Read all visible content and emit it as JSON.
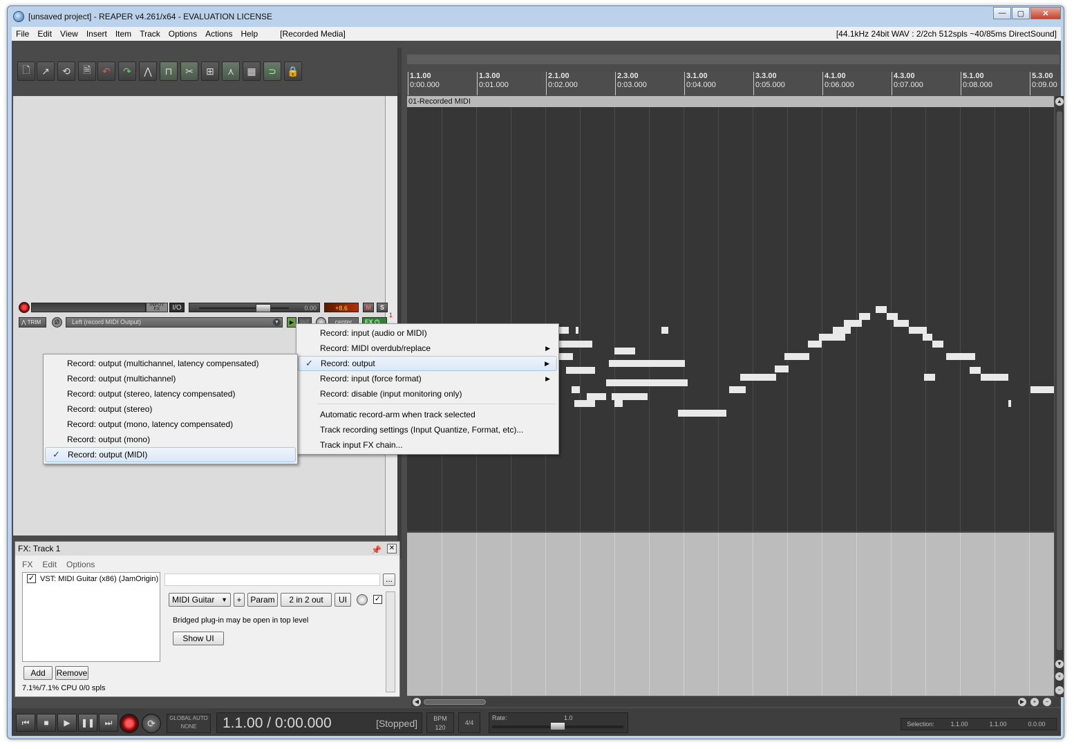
{
  "window": {
    "title": "[unsaved project] - REAPER v4.261/x64 - EVALUATION LICENSE",
    "minimize": "—",
    "maximize": "▢",
    "close": "✕"
  },
  "menubar": {
    "items": [
      "File",
      "Edit",
      "View",
      "Insert",
      "Item",
      "Track",
      "Options",
      "Actions",
      "Help"
    ],
    "extra": "[Recorded Media]",
    "status": "[44.1kHz 24bit WAV : 2/2ch 512spls ~40/85ms DirectSound]"
  },
  "toolbar": {
    "icons": [
      "new-project-icon",
      "open-project-icon",
      "save-icon",
      "project-settings-icon",
      "undo-icon",
      "redo-icon",
      "metronome-icon",
      "snap-icon",
      "ripple-icon",
      "grouping-icon",
      "envelope-icon",
      "grid-icon",
      "loop-icon",
      "lock-icon"
    ]
  },
  "ruler": {
    "marks": [
      {
        "bar": "1.1.00",
        "time": "0:00.000"
      },
      {
        "bar": "1.3.00",
        "time": "0:01.000"
      },
      {
        "bar": "2.1.00",
        "time": "0:02.000"
      },
      {
        "bar": "2.3.00",
        "time": "0:03.000"
      },
      {
        "bar": "3.1.00",
        "time": "0:04.000"
      },
      {
        "bar": "3.3.00",
        "time": "0:05.000"
      },
      {
        "bar": "4.1.00",
        "time": "0:06.000"
      },
      {
        "bar": "4.3.00",
        "time": "0:07.000"
      },
      {
        "bar": "5.1.00",
        "time": "0:08.000"
      },
      {
        "bar": "5.3.00",
        "time": "0:09.00"
      }
    ]
  },
  "track": {
    "number": "1",
    "input_fx": "INPUT FX",
    "io": "I/O",
    "volume": "0.00",
    "peak": "+8.6",
    "mute": "M",
    "solo": "S",
    "trim": "TRIM",
    "phase": "Ø",
    "record_mode": "Left (record MIDI Output)",
    "monitor": "▶",
    "out": "OUT",
    "pan": "center",
    "fx": "FX ⏻"
  },
  "item": {
    "name": "01-Recorded MIDI"
  },
  "context_menu_main": {
    "items": [
      {
        "label": "Record: input (audio or MIDI)",
        "checked": false,
        "submenu": false
      },
      {
        "label": "Record: MIDI overdub/replace",
        "checked": false,
        "submenu": true
      },
      {
        "label": "Record: output",
        "checked": true,
        "submenu": true,
        "highlight": true
      },
      {
        "label": "Record: input (force format)",
        "checked": false,
        "submenu": true
      },
      {
        "label": "Record: disable (input monitoring only)",
        "checked": false,
        "submenu": false
      },
      {
        "label": "Automatic record-arm when track selected",
        "checked": false,
        "submenu": false
      },
      {
        "label": "Track recording settings (Input Quantize, Format, etc)...",
        "checked": false,
        "submenu": false
      },
      {
        "label": "Track input FX chain...",
        "checked": false,
        "submenu": false
      }
    ]
  },
  "context_menu_sub": {
    "items": [
      {
        "label": "Record: output (multichannel, latency compensated)",
        "checked": false
      },
      {
        "label": "Record: output (multichannel)",
        "checked": false
      },
      {
        "label": "Record: output (stereo, latency compensated)",
        "checked": false
      },
      {
        "label": "Record: output (stereo)",
        "checked": false
      },
      {
        "label": "Record: output (mono, latency compensated)",
        "checked": false
      },
      {
        "label": "Record: output (mono)",
        "checked": false
      },
      {
        "label": "Record: output (MIDI)",
        "checked": true,
        "highlight": true
      }
    ]
  },
  "fx_window": {
    "title": "FX: Track 1",
    "pin": "📌",
    "close": "✕",
    "menu": [
      "FX",
      "Edit",
      "Options"
    ],
    "plugin": "VST: MIDI Guitar (x86) (JamOrigin)",
    "plugin_enabled": true,
    "preset_more": "...",
    "preset_select": "MIDI Guitar",
    "add_preset": "+",
    "param": "Param",
    "io": "2 in 2 out",
    "ui": "UI",
    "bridged_note": "Bridged plug-in may be open in top level",
    "show_ui": "Show UI",
    "add": "Add",
    "remove": "Remove",
    "cpu": "7.1%/7.1% CPU 0/0 spls"
  },
  "transport": {
    "global_auto": "GLOBAL AUTO",
    "global_auto_mode": "NONE",
    "position": "1.1.00 / 0:00.000",
    "state": "[Stopped]",
    "bpm_label": "BPM",
    "bpm": "120",
    "time_sig": "4/4",
    "rate_label": "Rate:",
    "rate": "1.0",
    "selection_label": "Selection:",
    "sel_start": "1.1.00",
    "sel_end": "1.1.00",
    "sel_len": "0.0.00"
  },
  "colors": {
    "accent": "#3a6da6",
    "record": "#ff3a3a",
    "note": "#e9e9e9"
  }
}
